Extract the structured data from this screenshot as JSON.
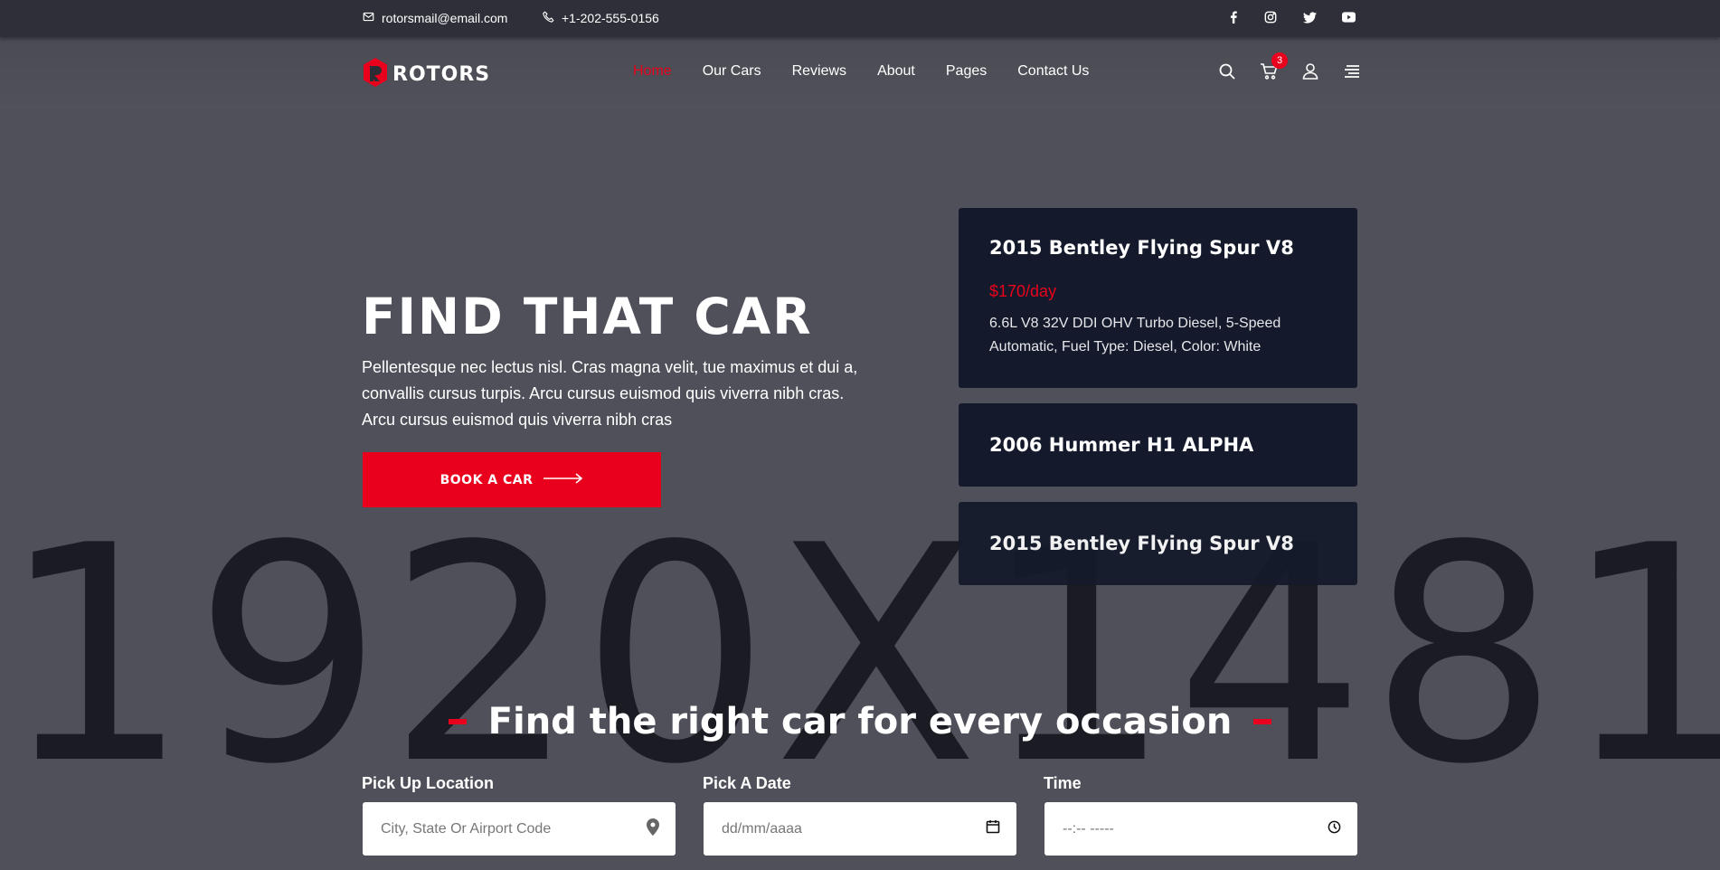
{
  "topbar": {
    "email": "rotorsmail@email.com",
    "phone": "+1-202-555-0156",
    "social": [
      "facebook-icon",
      "instagram-icon",
      "twitter-icon",
      "youtube-icon"
    ]
  },
  "header": {
    "logo_text": "ROTORS",
    "nav": [
      {
        "label": "Home",
        "active": true
      },
      {
        "label": "Our Cars"
      },
      {
        "label": "Reviews"
      },
      {
        "label": "About"
      },
      {
        "label": "Pages"
      },
      {
        "label": "Contact Us"
      }
    ],
    "cart_count": "3",
    "icons": [
      "search-icon",
      "cart-icon",
      "user-icon",
      "menu-icon"
    ]
  },
  "hero": {
    "title": "FIND THAT CAR",
    "description": "Pellentesque nec lectus nisl. Cras magna velit, tue maximus et dui a, convallis cursus turpis. Arcu cursus euismod quis viverra nibh cras. Arcu cursus euismod quis viverra nibh cras",
    "cta": "BOOK A CAR"
  },
  "watermark": "1920X1481",
  "cars": [
    {
      "name": "2015 Bentley Flying Spur V8",
      "price": "$170/day",
      "spec": "6.6L V8 32V DDI OHV Turbo Diesel, 5-Speed Automatic, Fuel Type: Diesel, Color: White"
    },
    {
      "name": "2006 Hummer H1 ALPHA"
    },
    {
      "name": "2015 Bentley Flying Spur V8"
    }
  ],
  "search": {
    "title": "Find the right car for every occasion",
    "fields": [
      {
        "label": "Pick Up Location",
        "placeholder": "City, State Or Airport Code",
        "icon": "location-pin-icon"
      },
      {
        "label": "Pick A Date",
        "placeholder": "dd/mm/aaaa",
        "icon": "calendar-icon"
      },
      {
        "label": "Time",
        "placeholder": "--:-- -----",
        "icon": "clock-icon"
      }
    ]
  },
  "colors": {
    "accent": "#e8001d",
    "card_bg": "#141a2b",
    "topbar_bg": "#2e2f39"
  }
}
